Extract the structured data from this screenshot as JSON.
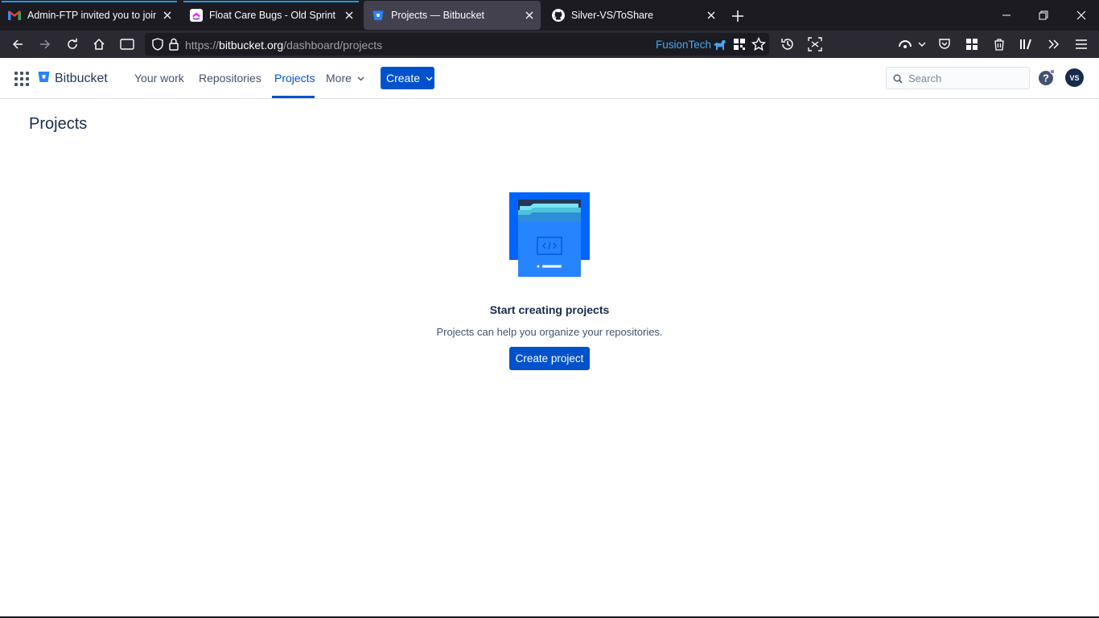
{
  "browser": {
    "tabs": [
      {
        "title": "Admin-FTP invited you to join t",
        "icon": "gmail-icon"
      },
      {
        "title": "Float Care Bugs - Old Sprint | Fl",
        "icon": "clickup-icon"
      },
      {
        "title": "Projects — Bitbucket",
        "icon": "bitbucket-icon",
        "active": true
      },
      {
        "title": "Silver-VS/ToShare",
        "icon": "github-icon"
      }
    ],
    "url_scheme": "https://",
    "url_host": "bitbucket.org",
    "url_path": "/dashboard/projects",
    "container_label": "FusionTech"
  },
  "app": {
    "brand": "Bitbucket",
    "nav": {
      "your_work": "Your work",
      "repositories": "Repositories",
      "projects": "Projects",
      "more": "More"
    },
    "create_label": "Create",
    "search_placeholder": "Search",
    "avatar_initials": "VS"
  },
  "page": {
    "title": "Projects",
    "empty_title": "Start creating projects",
    "empty_description": "Projects can help you organize your repositories.",
    "create_project_label": "Create project"
  },
  "colors": {
    "primary": "#0052cc",
    "text": "#172b4d",
    "browser_bg": "#1c1b22"
  }
}
